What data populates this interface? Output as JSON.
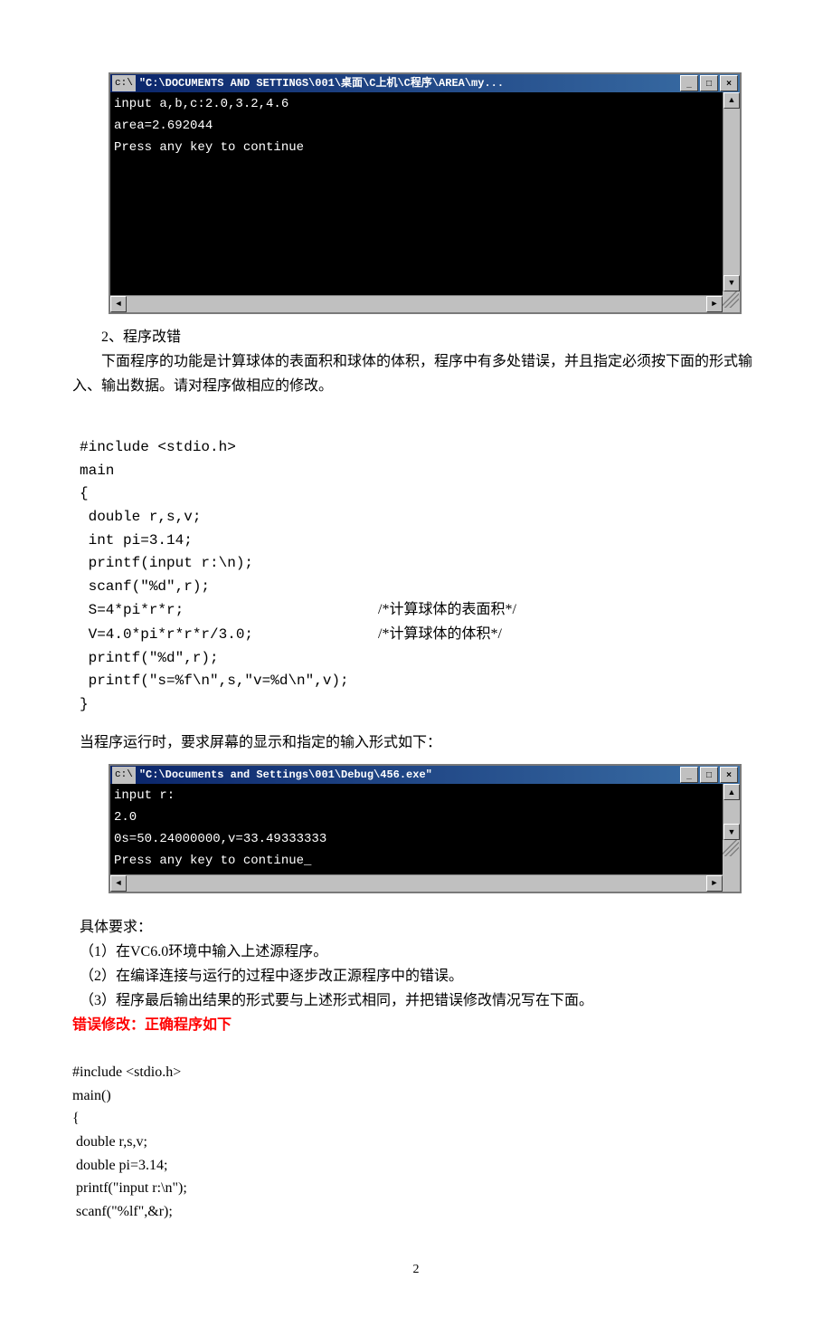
{
  "console1": {
    "icon": "c:\\",
    "title": "\"C:\\DOCUMENTS AND SETTINGS\\001\\桌面\\C上机\\C程序\\AREA\\my...",
    "output": "input a,b,c:2.0,3.2,4.6\narea=2.692044\nPress any key to continue"
  },
  "text": {
    "sec2_title": "2、程序改错",
    "sec2_desc": "下面程序的功能是计算球体的表面积和球体的体积，程序中有多处错误，并且指定必须按下面的形式输入、输出数据。请对程序做相应的修改。",
    "code1_l1": "#include <stdio.h>",
    "code1_l2": "main",
    "code1_l3": "{",
    "code1_l4": " double r,s,v;",
    "code1_l5": " int pi=3.14;",
    "code1_l6": " printf(input r:\\n);",
    "code1_l7": " scanf(\"%d\",r);",
    "code1_l8a": " S=4*pi*r*r;",
    "code1_l8b": "/*计算球体的表面积*/",
    "code1_l9a": " V=4.0*pi*r*r*r/3.0;",
    "code1_l9b": "/*计算球体的体积*/",
    "code1_l10": " printf(\"%d\",r);",
    "code1_l11": " printf(\"s=%f\\n\",s,\"v=%d\\n\",v);",
    "code1_l12": "}",
    "run_desc": "当程序运行时，要求屏幕的显示和指定的输入形式如下：",
    "req_title": "具体要求：",
    "req1": "（1）在VC6.0环境中输入上述源程序。",
    "req2": "（2）在编译连接与运行的过程中逐步改正源程序中的错误。",
    "req3": "（3）程序最后输出结果的形式要与上述形式相同，并把错误修改情况写在下面。",
    "fix_title": "错误修改：正确程序如下",
    "code2_l1": "#include <stdio.h>",
    "code2_l2": "main()",
    "code2_l3": "{",
    "code2_l4": " double r,s,v;",
    "code2_l5": " double pi=3.14;",
    "code2_l6": " printf(\"input r:\\n\");",
    "code2_l7": " scanf(\"%lf\",&r);"
  },
  "console2": {
    "icon": "c:\\",
    "title": "\"C:\\Documents and Settings\\001\\Debug\\456.exe\"",
    "output": "input r:\n2.0\n0s=50.24000000,v=33.49333333\nPress any key to continue_"
  },
  "buttons": {
    "min": "_",
    "max": "□",
    "close": "×",
    "up": "▲",
    "down": "▼",
    "left": "◄",
    "right": "►"
  },
  "page_number": "2"
}
